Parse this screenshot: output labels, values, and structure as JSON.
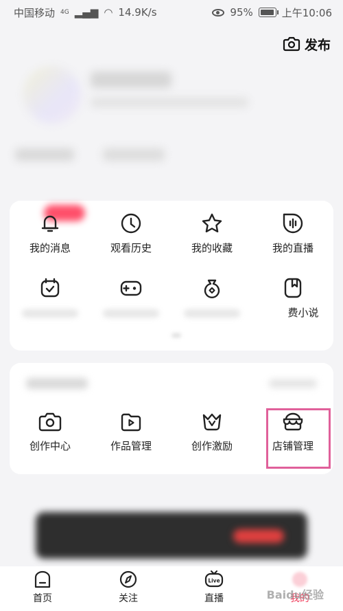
{
  "status_bar": {
    "carrier": "中国移动",
    "network": "4G",
    "speed": "14.9K/s",
    "battery": "95%",
    "time": "上午10:06",
    "icons": [
      "signal-icon",
      "wifi-icon",
      "eye-icon",
      "battery-icon"
    ]
  },
  "header": {
    "publish_label": "发布",
    "publish_icon": "camera-icon"
  },
  "functions": {
    "items": [
      {
        "label": "我的消息",
        "icon": "bell-icon"
      },
      {
        "label": "观看历史",
        "icon": "clock-icon"
      },
      {
        "label": "我的收藏",
        "icon": "star-icon"
      },
      {
        "label": "我的直播",
        "icon": "live-icon"
      },
      {
        "label": "",
        "icon": "calendar-check-icon"
      },
      {
        "label": "",
        "icon": "gamepad-icon"
      },
      {
        "label": "",
        "icon": "money-bag-icon"
      },
      {
        "label": "费小说",
        "icon": "book-icon"
      }
    ]
  },
  "creator": {
    "items": [
      {
        "label": "创作中心",
        "icon": "camera-icon"
      },
      {
        "label": "作品管理",
        "icon": "video-folder-icon"
      },
      {
        "label": "创作激励",
        "icon": "crown-icon"
      },
      {
        "label": "店铺管理",
        "icon": "store-icon"
      }
    ]
  },
  "tabbar": {
    "tabs": [
      {
        "label": "首页",
        "icon": "home-icon"
      },
      {
        "label": "关注",
        "icon": "compass-icon"
      },
      {
        "label": "直播",
        "icon": "live-tv-icon"
      },
      {
        "label": "我的",
        "icon": "profile-icon"
      }
    ]
  },
  "watermark": "Baidu经验",
  "colors": {
    "accent": "#f0405e",
    "highlight": "#e0609a"
  }
}
